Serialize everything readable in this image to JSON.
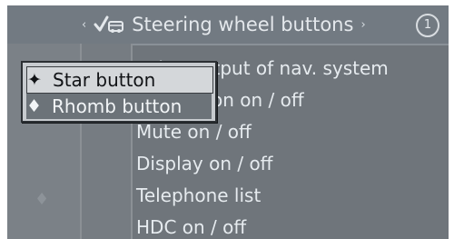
{
  "header": {
    "title": "Steering wheel buttons",
    "left_arrow": "‹",
    "right_arrow": "›",
    "badge": "1",
    "check_glyph": "✓",
    "icon": "steering-car-icon"
  },
  "menu": {
    "items": [
      "Voice output of nav. system",
      "Navigation on / off",
      "Mute on / off",
      "Display on / off",
      "Telephone list",
      "HDC on / off"
    ]
  },
  "popup": {
    "items": [
      {
        "glyph": "✦",
        "label": "Star button"
      },
      {
        "glyph": "♦",
        "label": "Rhomb button"
      }
    ]
  },
  "decor": {
    "faint_glyph": "♦"
  },
  "colors": {
    "screen_bg": "#6f757b",
    "text": "#e6ebef",
    "popup_bg": "#c7cbcf",
    "popup_highlight": "#d4d7da",
    "popup_selected": "#6c7379"
  }
}
